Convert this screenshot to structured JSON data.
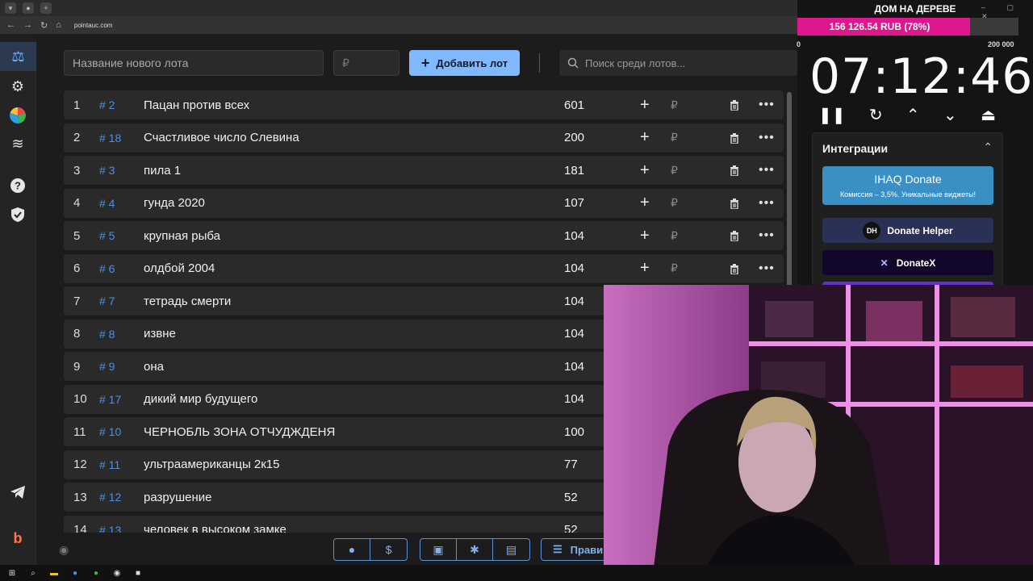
{
  "browser": {
    "url": "pointauc.com"
  },
  "toolbar": {
    "new_lot_placeholder": "Название нового лота",
    "price_placeholder": "₽",
    "add_button_label": "Добавить лот",
    "search_placeholder": "Поиск среди лотов..."
  },
  "lots": [
    {
      "index": "1",
      "id": "# 2",
      "name": "Пацан против всех",
      "amount": "601"
    },
    {
      "index": "2",
      "id": "# 18",
      "name": "Счастливое число Слевина",
      "amount": "200"
    },
    {
      "index": "3",
      "id": "# 3",
      "name": "пила 1",
      "amount": "181"
    },
    {
      "index": "4",
      "id": "# 4",
      "name": "гунда 2020",
      "amount": "107"
    },
    {
      "index": "5",
      "id": "# 5",
      "name": "крупная рыба",
      "amount": "104"
    },
    {
      "index": "6",
      "id": "# 6",
      "name": "олдбой 2004",
      "amount": "104"
    },
    {
      "index": "7",
      "id": "# 7",
      "name": "тетрадь смерти",
      "amount": "104"
    },
    {
      "index": "8",
      "id": "# 8",
      "name": "извне",
      "amount": "104"
    },
    {
      "index": "9",
      "id": "# 9",
      "name": "она",
      "amount": "104"
    },
    {
      "index": "10",
      "id": "# 17",
      "name": "дикий мир будущего",
      "amount": "104"
    },
    {
      "index": "11",
      "id": "# 10",
      "name": "ЧЕРНОБЛЬ ЗОНА ОТЧУДЖДЕНЯ",
      "amount": "100"
    },
    {
      "index": "12",
      "id": "# 11",
      "name": "ультраамериканцы 2к15",
      "amount": "77"
    },
    {
      "index": "13",
      "id": "# 12",
      "name": "разрушение",
      "amount": "52"
    },
    {
      "index": "14",
      "id": "# 13",
      "name": "человек в высоком замке",
      "amount": "52"
    }
  ],
  "lot_actions": {
    "plus": "+",
    "rub": "₽",
    "more": "•••"
  },
  "bottom_bar": {
    "rules_label": "Прави"
  },
  "overlay": {
    "title": "ДОМ НА ДЕРЕВЕ",
    "progress_text": "156 126.54 RUB (78%)",
    "progress_fraction": 0.78,
    "scale_min": "0",
    "scale_max": "200 000",
    "timer": "07:12:46"
  },
  "integrations": {
    "title": "Интеграции",
    "ihaq_title": "IHAQ Donate",
    "ihaq_sub": "Комиссия – 3,5%. Уникальные виджеты!",
    "donate_helper": "Donate Helper",
    "donate_helper_badge": "DH",
    "donatex": "DonateX"
  },
  "colors": {
    "accent": "#80b9ff",
    "progress": "#e0168f",
    "ihaq": "#3a8fc4",
    "donate_helper": "#293156",
    "donatex": "#12072b"
  }
}
